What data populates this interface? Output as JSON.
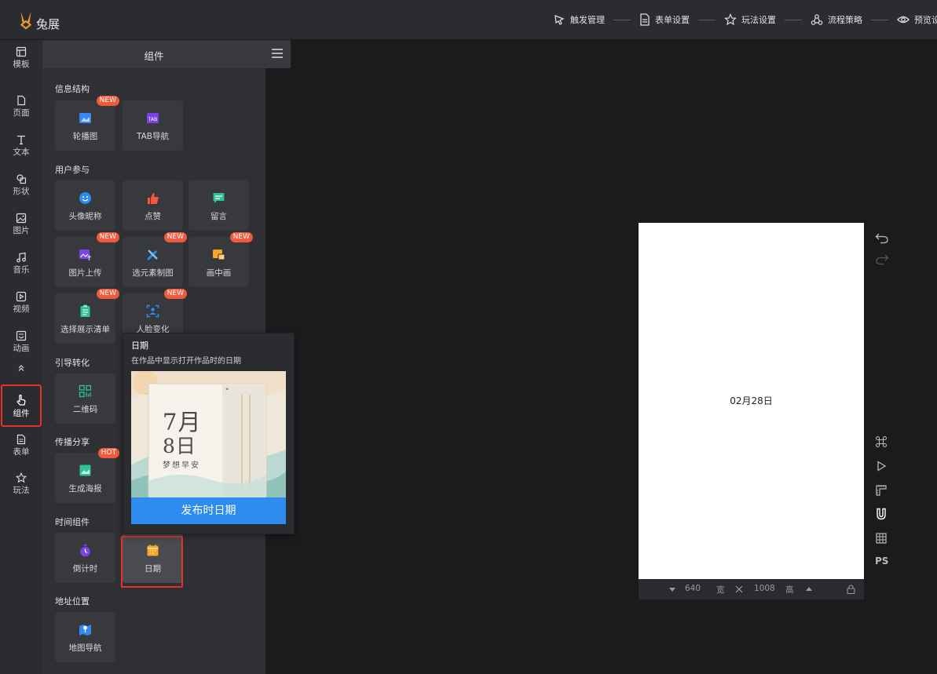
{
  "app": {
    "name": "兔展"
  },
  "steps": [
    {
      "label": "触发管理",
      "icon": "trigger-icon"
    },
    {
      "label": "表单设置",
      "icon": "form-icon"
    },
    {
      "label": "玩法设置",
      "icon": "star-icon"
    },
    {
      "label": "流程策略",
      "icon": "flow-icon"
    },
    {
      "label": "预览设",
      "icon": "eye-icon"
    }
  ],
  "rail": [
    {
      "label": "模板"
    },
    {
      "label": "页面"
    },
    {
      "label": "文本"
    },
    {
      "label": "形状"
    },
    {
      "label": "图片"
    },
    {
      "label": "音乐"
    },
    {
      "label": "视频"
    },
    {
      "label": "动画"
    },
    {
      "label": "组件"
    },
    {
      "label": "表单"
    },
    {
      "label": "玩法"
    }
  ],
  "panel": {
    "title": "组件",
    "sections": [
      {
        "title": "信息结构",
        "items": [
          {
            "label": "轮播图",
            "badge": "NEW"
          },
          {
            "label": "TAB导航",
            "badge": ""
          }
        ]
      },
      {
        "title": "用户参与",
        "items": [
          {
            "label": "头像昵称",
            "badge": ""
          },
          {
            "label": "点赞",
            "badge": ""
          },
          {
            "label": "留言",
            "badge": ""
          },
          {
            "label": "图片上传",
            "badge": "NEW"
          },
          {
            "label": "选元素制图",
            "badge": "NEW"
          },
          {
            "label": "画中画",
            "badge": "NEW"
          },
          {
            "label": "选择展示清单",
            "badge": "NEW"
          },
          {
            "label": "人脸变化",
            "badge": "NEW"
          }
        ]
      },
      {
        "title": "引导转化",
        "items": [
          {
            "label": "二维码",
            "badge": ""
          }
        ]
      },
      {
        "title": "传播分享",
        "items": [
          {
            "label": "生成海报",
            "badge": "HOT"
          }
        ]
      },
      {
        "title": "时间组件",
        "items": [
          {
            "label": "倒计时",
            "badge": ""
          },
          {
            "label": "日期",
            "badge": ""
          }
        ]
      },
      {
        "title": "地址位置",
        "items": [
          {
            "label": "地图导航",
            "badge": ""
          }
        ]
      }
    ]
  },
  "tooltip": {
    "title": "日期",
    "desc": "在作品中显示打开作品时的日期",
    "preview": {
      "month": "7月",
      "day": "8日",
      "slogan": "梦想早安"
    },
    "button": "发布时日期"
  },
  "canvas": {
    "text": "02月28日",
    "width": "640",
    "width_label": "宽",
    "height": "1008",
    "height_label": "高",
    "tool_ps": "PS"
  }
}
